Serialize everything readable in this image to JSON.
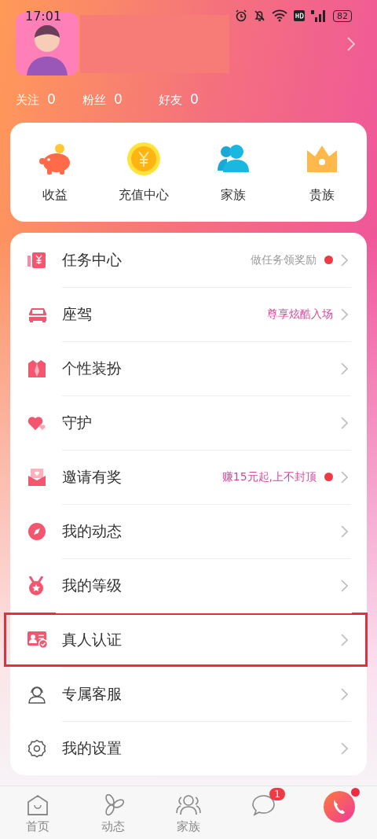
{
  "status_bar": {
    "time": "17:01",
    "battery": "82"
  },
  "profile": {
    "stats": [
      {
        "label": "关注",
        "value": "0"
      },
      {
        "label": "粉丝",
        "value": "0"
      },
      {
        "label": "好友",
        "value": "0"
      }
    ]
  },
  "quick_actions": [
    {
      "label": "收益",
      "kind": "piggy"
    },
    {
      "label": "充值中心",
      "kind": "coin"
    },
    {
      "label": "家族",
      "kind": "people"
    },
    {
      "label": "贵族",
      "kind": "crown"
    }
  ],
  "menu": [
    {
      "label": "任务中心",
      "kind": "task",
      "hint": "做任务领奖励",
      "accent": false,
      "dot": true,
      "highlighted": false
    },
    {
      "label": "座驾",
      "kind": "car",
      "hint": "尊享炫酷入场",
      "accent": true,
      "dot": false,
      "highlighted": false
    },
    {
      "label": "个性装扮",
      "kind": "suit",
      "dot": false,
      "highlighted": false
    },
    {
      "label": "守护",
      "kind": "heart",
      "dot": false,
      "highlighted": false
    },
    {
      "label": "邀请有奖",
      "kind": "mail",
      "hint": "赚15元起,上不封顶",
      "accent": true,
      "dot": true,
      "highlighted": false
    },
    {
      "label": "我的动态",
      "kind": "compass",
      "dot": false,
      "highlighted": false
    },
    {
      "label": "我的等级",
      "kind": "medal",
      "dot": false,
      "highlighted": false
    },
    {
      "label": "真人认证",
      "kind": "idcard",
      "dot": false,
      "highlighted": true
    },
    {
      "label": "专属客服",
      "kind": "agent",
      "dot": false,
      "highlighted": false
    },
    {
      "label": "我的设置",
      "kind": "gear",
      "dot": false,
      "highlighted": false
    }
  ],
  "tab_bar": [
    {
      "label": "首页",
      "kind": "home",
      "selected": false
    },
    {
      "label": "动态",
      "kind": "fan",
      "selected": false
    },
    {
      "label": "家族",
      "kind": "family",
      "selected": false
    },
    {
      "kind": "chat",
      "badge": "1",
      "selected": false
    },
    {
      "kind": "call",
      "dot": true,
      "selected": false
    }
  ]
}
